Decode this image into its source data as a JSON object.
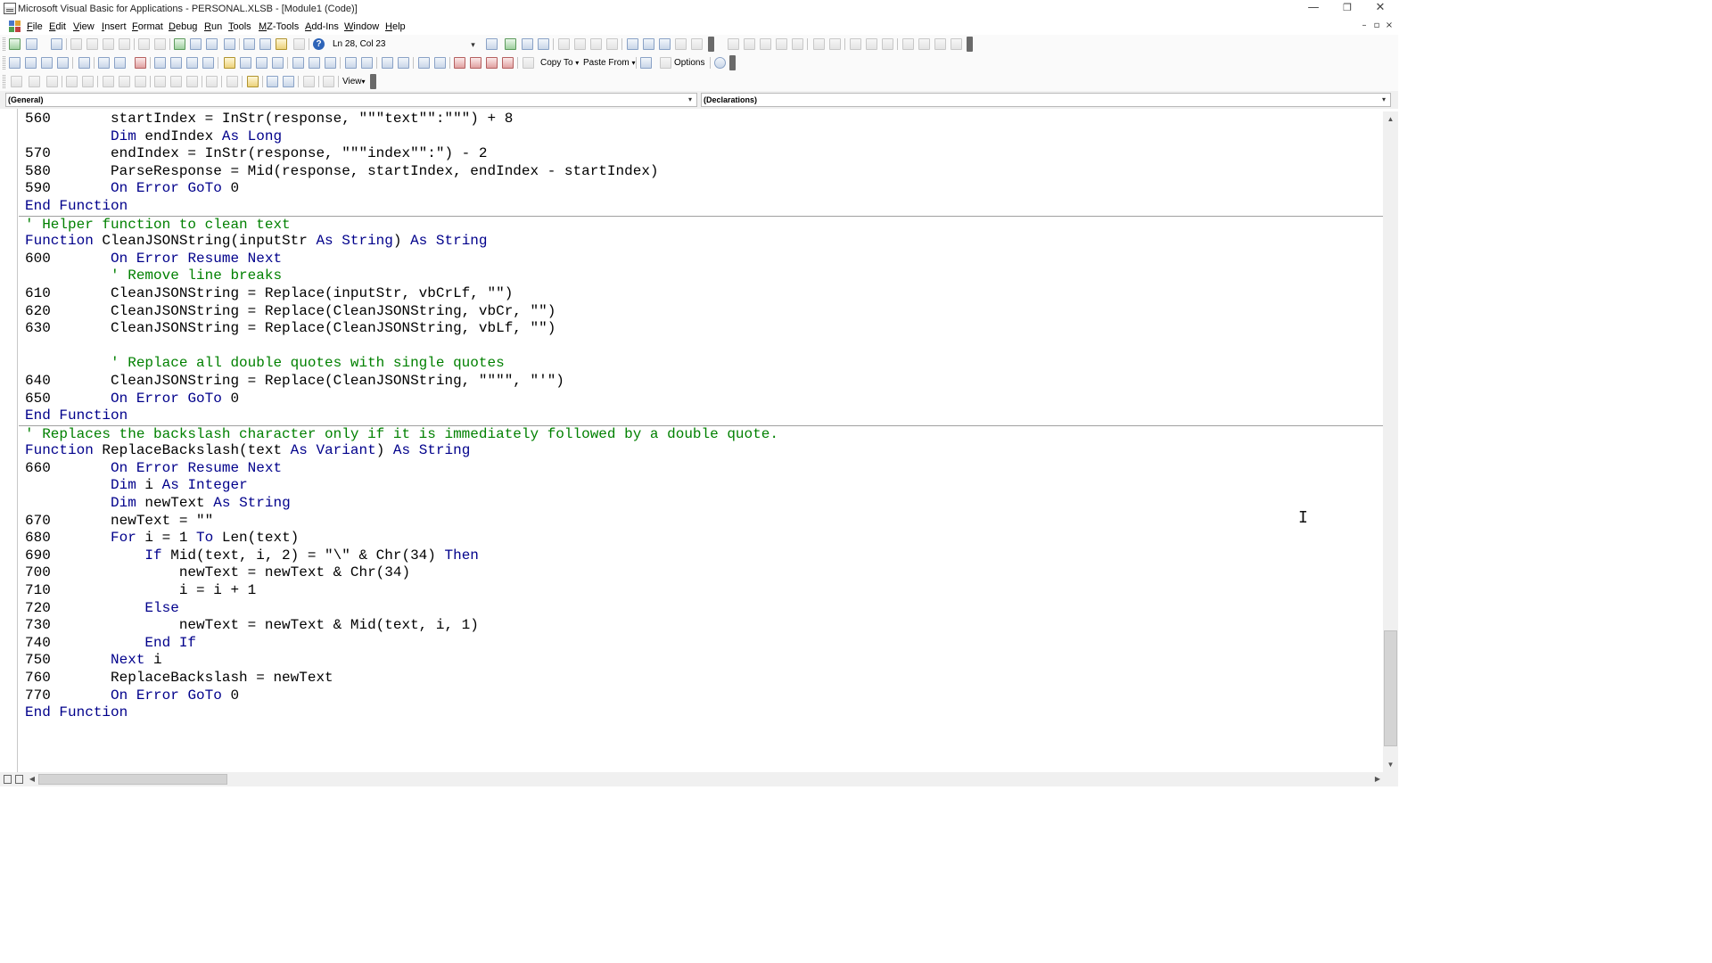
{
  "window": {
    "title": "Microsoft Visual Basic for Applications - PERSONAL.XLSB - [Module1 (Code)]",
    "min_glyph": "—",
    "max_glyph": "❐",
    "close_glyph": "✕"
  },
  "menu": {
    "items": [
      "File",
      "Edit",
      "View",
      "Insert",
      "Format",
      "Debug",
      "Run",
      "Tools",
      "MZ-Tools",
      "Add-Ins",
      "Window",
      "Help"
    ],
    "mdi_min": "–",
    "mdi_restore": "▫",
    "mdi_close": "×"
  },
  "toolbar": {
    "position": "Ln 28, Col 23",
    "help_glyph": "?",
    "copy_to": "Copy To",
    "paste_from": "Paste From",
    "options": "Options",
    "view": "View",
    "drop_glyph": "▾"
  },
  "combos": {
    "object": "(General)",
    "procedure": "(Declarations)"
  },
  "scroll": {
    "up": "▲",
    "down": "▼",
    "left": "◀",
    "right": "▶"
  },
  "cursor_glyph": "I",
  "code": [
    "560       startIndex = InStr(response, \"\"\"text\"\":\"\"\") + 8",
    "          Dim endIndex As Long",
    "570       endIndex = InStr(response, \"\"\"index\"\":\") - 2",
    "580       ParseResponse = Mid(response, startIndex, endIndex - startIndex)",
    "590       On Error GoTo 0",
    "End Function",
    "' Helper function to clean text",
    "Function CleanJSONString(inputStr As String) As String",
    "600       On Error Resume Next",
    "          ' Remove line breaks",
    "610       CleanJSONString = Replace(inputStr, vbCrLf, \"\")",
    "620       CleanJSONString = Replace(CleanJSONString, vbCr, \"\")",
    "630       CleanJSONString = Replace(CleanJSONString, vbLf, \"\")",
    "",
    "          ' Replace all double quotes with single quotes",
    "640       CleanJSONString = Replace(CleanJSONString, \"\"\"\", \"'\")",
    "650       On Error GoTo 0",
    "End Function",
    "' Replaces the backslash character only if it is immediately followed by a double quote.",
    "Function ReplaceBackslash(text As Variant) As String",
    "660       On Error Resume Next",
    "          Dim i As Integer",
    "          Dim newText As String",
    "670       newText = \"\"",
    "680       For i = 1 To Len(text)",
    "690           If Mid(text, i, 2) = \"\\\" & Chr(34) Then",
    "700               newText = newText & Chr(34)",
    "710               i = i + 1",
    "720           Else",
    "730               newText = newText & Mid(text, i, 1)",
    "740           End If",
    "750       Next i",
    "760       ReplaceBackslash = newText",
    "770       On Error GoTo 0",
    "End Function"
  ],
  "separator_lines": [
    6,
    18
  ],
  "colors": {
    "keyword": "#00008b",
    "comment": "#008000",
    "text": "#000000"
  }
}
